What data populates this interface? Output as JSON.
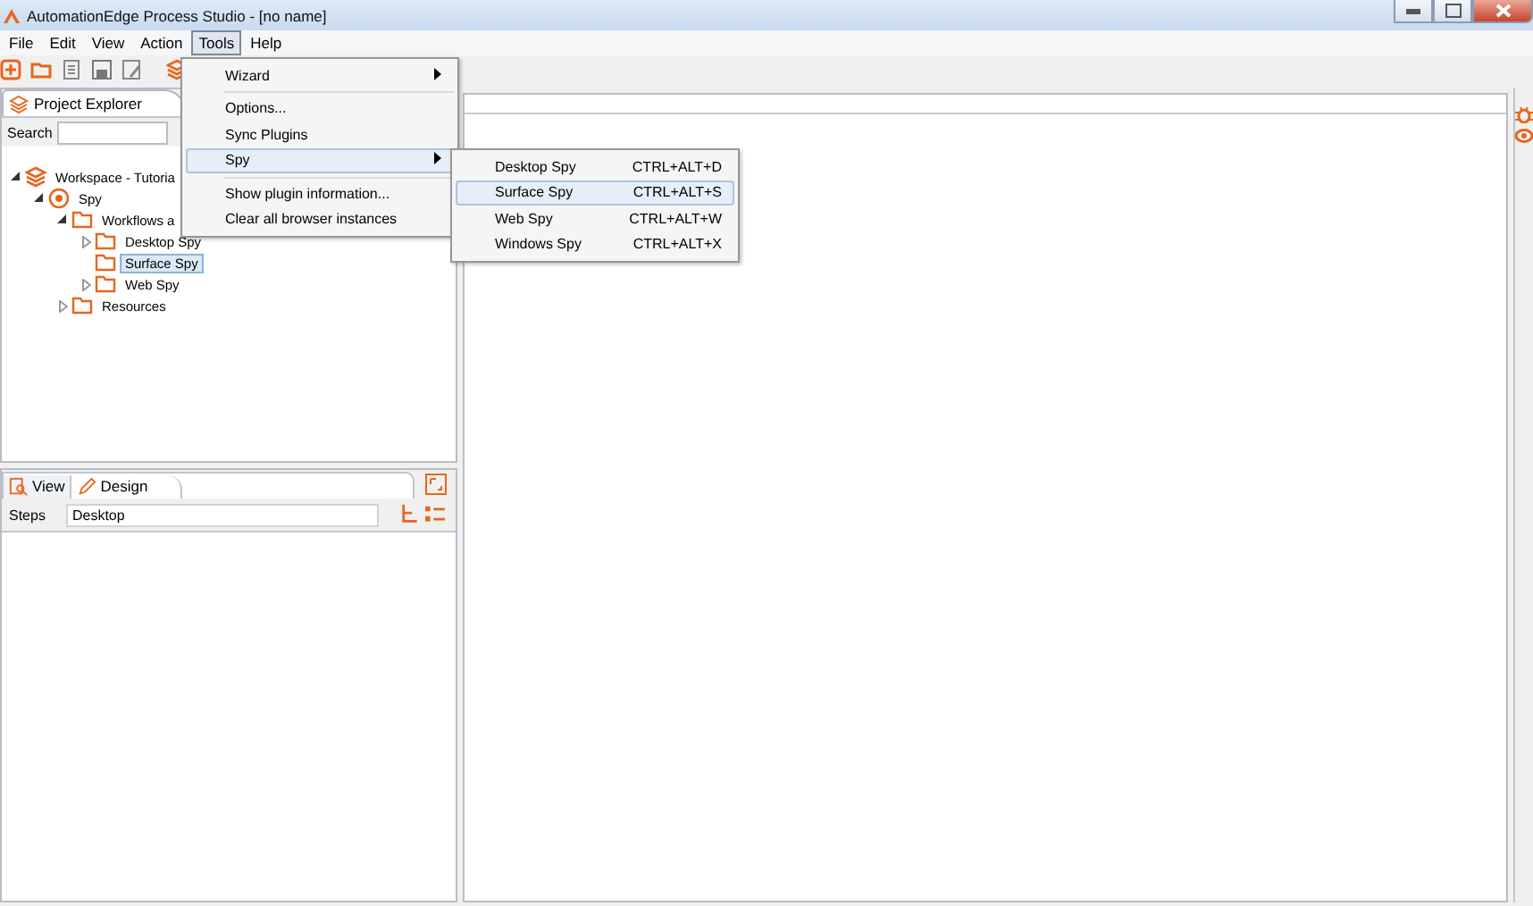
{
  "window": {
    "title": "AutomationEdge Process Studio - [no name]"
  },
  "menubar": [
    {
      "label": "File",
      "selected": false
    },
    {
      "label": "Edit",
      "selected": false
    },
    {
      "label": "View",
      "selected": false
    },
    {
      "label": "Action",
      "selected": false
    },
    {
      "label": "Tools",
      "selected": true
    },
    {
      "label": "Help",
      "selected": false
    }
  ],
  "toolbar": [
    {
      "kind": "new"
    },
    {
      "kind": "open"
    },
    {
      "kind": "page"
    },
    {
      "kind": "save"
    },
    {
      "kind": "saveas"
    },
    {
      "kind": "layers"
    }
  ],
  "project_explorer": {
    "tab": "Project Explorer",
    "search_label": "Search",
    "tree": [
      {
        "label": "Workspace - Tutoria",
        "kind": "workspace",
        "expanded": true,
        "selected": false,
        "children": [
          {
            "label": "Spy",
            "kind": "project",
            "expanded": true,
            "selected": false,
            "children": [
              {
                "label": "Workflows a",
                "kind": "folder",
                "expanded": true,
                "selected": false,
                "children": [
                  {
                    "label": "Desktop Spy",
                    "kind": "folder",
                    "expanded": false,
                    "selected": false
                  },
                  {
                    "label": "Surface Spy",
                    "kind": "folder",
                    "selected": true
                  },
                  {
                    "label": "Web Spy",
                    "kind": "folder",
                    "expanded": false,
                    "selected": false
                  }
                ]
              },
              {
                "label": "Resources",
                "kind": "folder",
                "expanded": false,
                "selected": false
              }
            ]
          }
        ]
      }
    ]
  },
  "bottom_panel": {
    "tabs": [
      {
        "label": "View",
        "kind": "view",
        "selected": false
      },
      {
        "label": "Design",
        "kind": "design",
        "selected": true
      }
    ],
    "steps_label": "Steps",
    "steps_value": "Desktop"
  },
  "tools_menu": [
    {
      "label": "Wizard",
      "kind": "submenu",
      "selected": false,
      "separator_after": true
    },
    {
      "label": "Options...",
      "kind": "command",
      "selected": false,
      "separator_after": false
    },
    {
      "label": "Sync Plugins",
      "kind": "command",
      "selected": false,
      "separator_after": false
    },
    {
      "label": "Spy",
      "kind": "submenu",
      "selected": true,
      "separator_after": true
    },
    {
      "label": "Show plugin information...",
      "kind": "command",
      "selected": false,
      "separator_after": false
    },
    {
      "label": "Clear all browser instances",
      "kind": "command",
      "selected": false,
      "separator_after": false
    }
  ],
  "spy_submenu": [
    {
      "label": "Desktop Spy",
      "shortcut": "CTRL+ALT+D",
      "selected": false
    },
    {
      "label": "Surface Spy",
      "shortcut": "CTRL+ALT+S",
      "selected": true
    },
    {
      "label": "Web Spy",
      "shortcut": "CTRL+ALT+W",
      "selected": false
    },
    {
      "label": "Windows Spy",
      "shortcut": "CTRL+ALT+X",
      "selected": false
    }
  ]
}
